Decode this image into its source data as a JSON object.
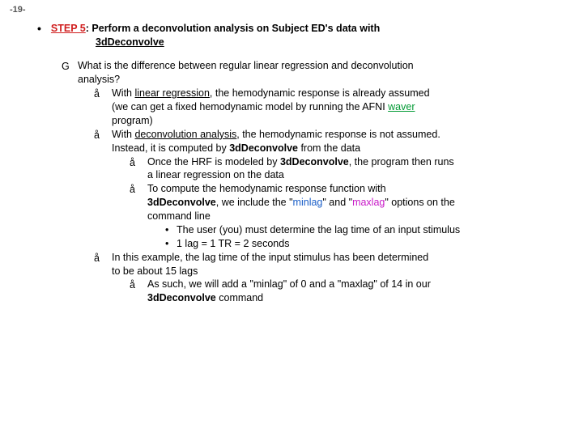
{
  "pageNumber": "-19-",
  "step": {
    "bullet": "•",
    "label": "STEP 5",
    "colon": ": ",
    "rest": "Perform a deconvolution analysis on Subject ED's data with",
    "indent": "3dDeconvolve"
  },
  "l1": {
    "icon": "G",
    "text1": "What is the difference between regular linear regression and deconvolution",
    "text2": "analysis?"
  },
  "l2a": {
    "icon": "å",
    "pre": "With ",
    "u": "linear regression",
    "post1": ", the hemodynamic response is already assumed",
    "line2a": "(we can get a fixed hemodynamic model by running the AFNI ",
    "waver": "waver",
    "line3": "program)"
  },
  "l2b": {
    "icon": "å",
    "pre": "With ",
    "u": "deconvolution analysis",
    "post1": ", the hemodynamic response is not assumed.",
    "line2a": "Instead, it is computed by ",
    "prog": "3dDeconvolve",
    "line2b": " from the data"
  },
  "l3a": {
    "icon": "å",
    "text1a": "Once the HRF is modeled by ",
    "prog": "3dDeconvolve",
    "text1b": ", the program then runs",
    "text2": "a linear regression on the data"
  },
  "l3b": {
    "icon": "å",
    "text1": "To compute the hemodynamic response function with",
    "prog": "3dDeconvolve",
    "text2a": ", we include the \"",
    "minlag": "minlag",
    "text2b": "\" and \"",
    "maxlag": "maxlag",
    "text2c": "\" options on the",
    "text3": "command line"
  },
  "l4a": {
    "icon": "•",
    "text": "The user (you) must determine the lag time of an input stimulus"
  },
  "l4b": {
    "icon": "•",
    "text": "1 lag = 1 TR = 2 seconds"
  },
  "l2c": {
    "icon": "å",
    "text1": "In this example, the lag time of the input stimulus has been determined",
    "text2": "to be about 15 lags"
  },
  "l3c": {
    "icon": "å",
    "text1": "As such, we will add a \"minlag\" of 0 and a \"maxlag\" of 14 in our",
    "prog": "3dDeconvolve",
    "text2": " command"
  }
}
